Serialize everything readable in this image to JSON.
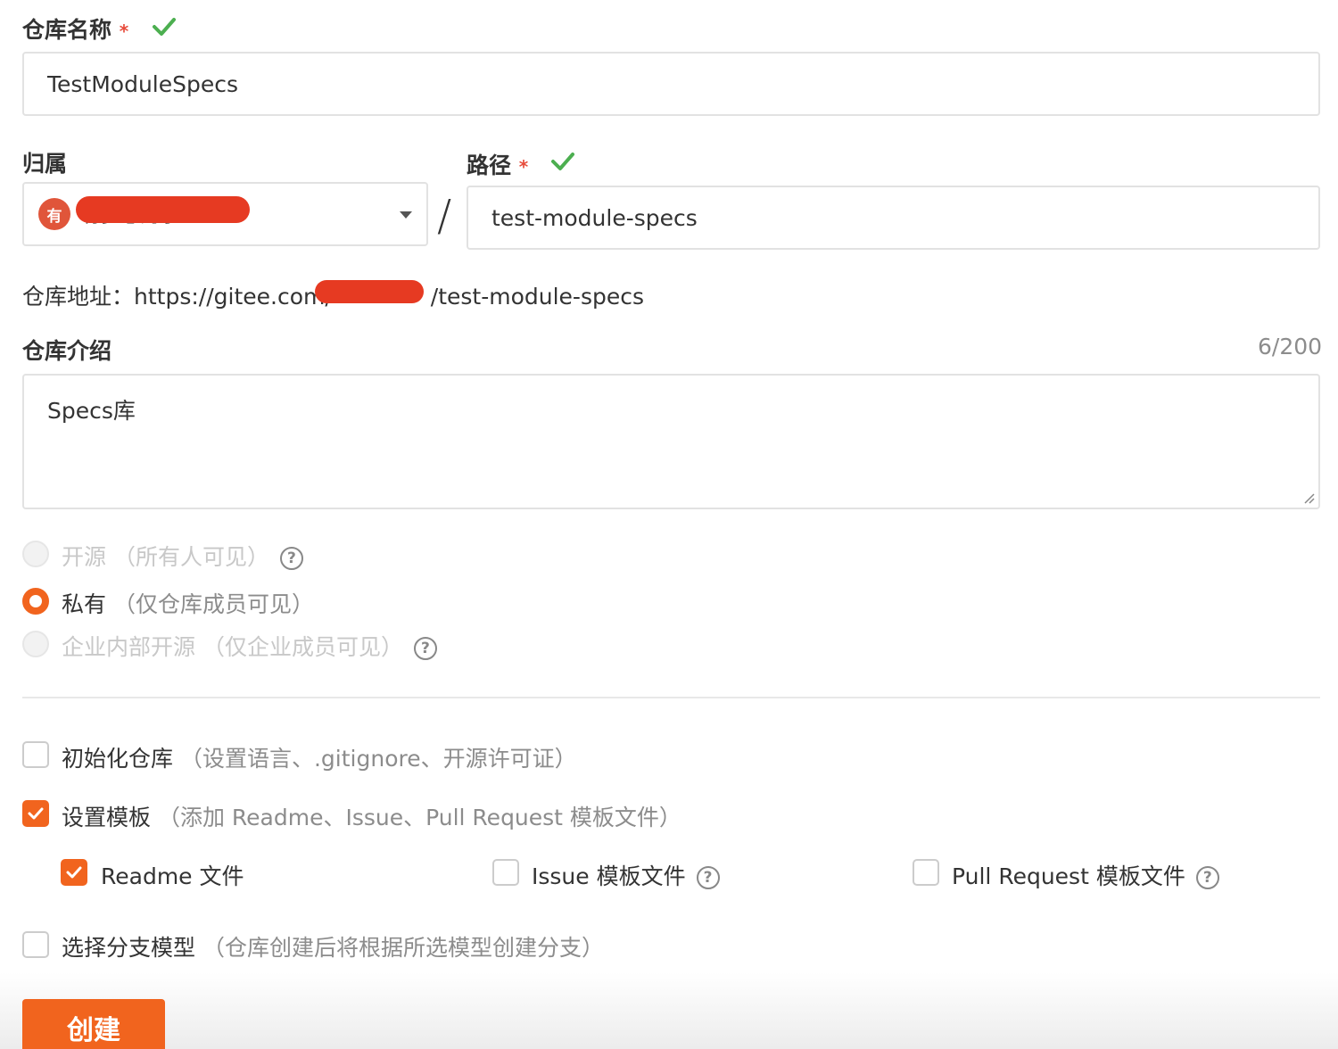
{
  "repo_name": {
    "label": "仓库名称",
    "required_mark": "*",
    "value": "TestModuleSpecs"
  },
  "owner": {
    "label": "归属",
    "avatar_text": "有",
    "value": "有多思的小..."
  },
  "path": {
    "label": "路径",
    "required_mark": "*",
    "separator": "/",
    "value": "test-module-specs"
  },
  "repo_address": {
    "prefix": "仓库地址：",
    "url_start": "https://gitee.com/",
    "url_end": "/test-module-specs"
  },
  "description": {
    "label": "仓库介绍",
    "counter": "6/200",
    "value": "Specs库"
  },
  "visibility": {
    "options": [
      {
        "label": "开源",
        "hint": "（所有人可见）",
        "selected": false,
        "disabled": true,
        "help": true
      },
      {
        "label": "私有",
        "hint": "（仅仓库成员可见）",
        "selected": true,
        "disabled": false,
        "help": false
      },
      {
        "label": "企业内部开源",
        "hint": "（仅企业成员可见）",
        "selected": false,
        "disabled": true,
        "help": true
      }
    ]
  },
  "init_repo": {
    "label": "初始化仓库",
    "hint": "（设置语言、.gitignore、开源许可证）",
    "checked": false
  },
  "template": {
    "label": "设置模板",
    "hint": "（添加 Readme、Issue、Pull Request 模板文件）",
    "checked": true,
    "items": [
      {
        "label": "Readme 文件",
        "checked": true,
        "help": false
      },
      {
        "label": "Issue 模板文件",
        "checked": false,
        "help": true
      },
      {
        "label": "Pull Request 模板文件",
        "checked": false,
        "help": true
      }
    ]
  },
  "branch_model": {
    "label": "选择分支模型",
    "hint": "（仓库创建后将根据所选模型创建分支）",
    "checked": false
  },
  "help_glyph": "?",
  "submit": {
    "label": "创建"
  },
  "colors": {
    "accent": "#f1641e",
    "success": "#4caf50",
    "required": "#e74c3c"
  }
}
